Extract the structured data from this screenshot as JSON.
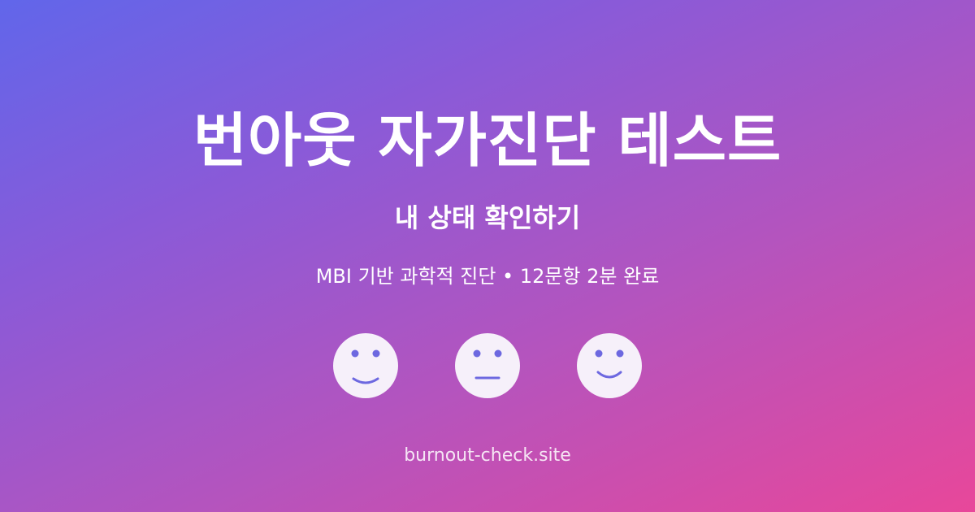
{
  "header": {
    "title": "번아웃 자가진단 테스트",
    "subtitle": "내 상태 확인하기",
    "tagline": "MBI 기반 과학적 진단 • 12문항 2분 완료"
  },
  "faces": [
    {
      "name": "smiling-face-icon"
    },
    {
      "name": "neutral-face-icon"
    },
    {
      "name": "happy-face-icon"
    }
  ],
  "footer": {
    "domain": "burnout-check.site"
  },
  "colors": {
    "gradient_start": "#6166ea",
    "gradient_end": "#e8479a",
    "face_fill": "#f6f0fa",
    "face_feature": "#6d68e0"
  }
}
